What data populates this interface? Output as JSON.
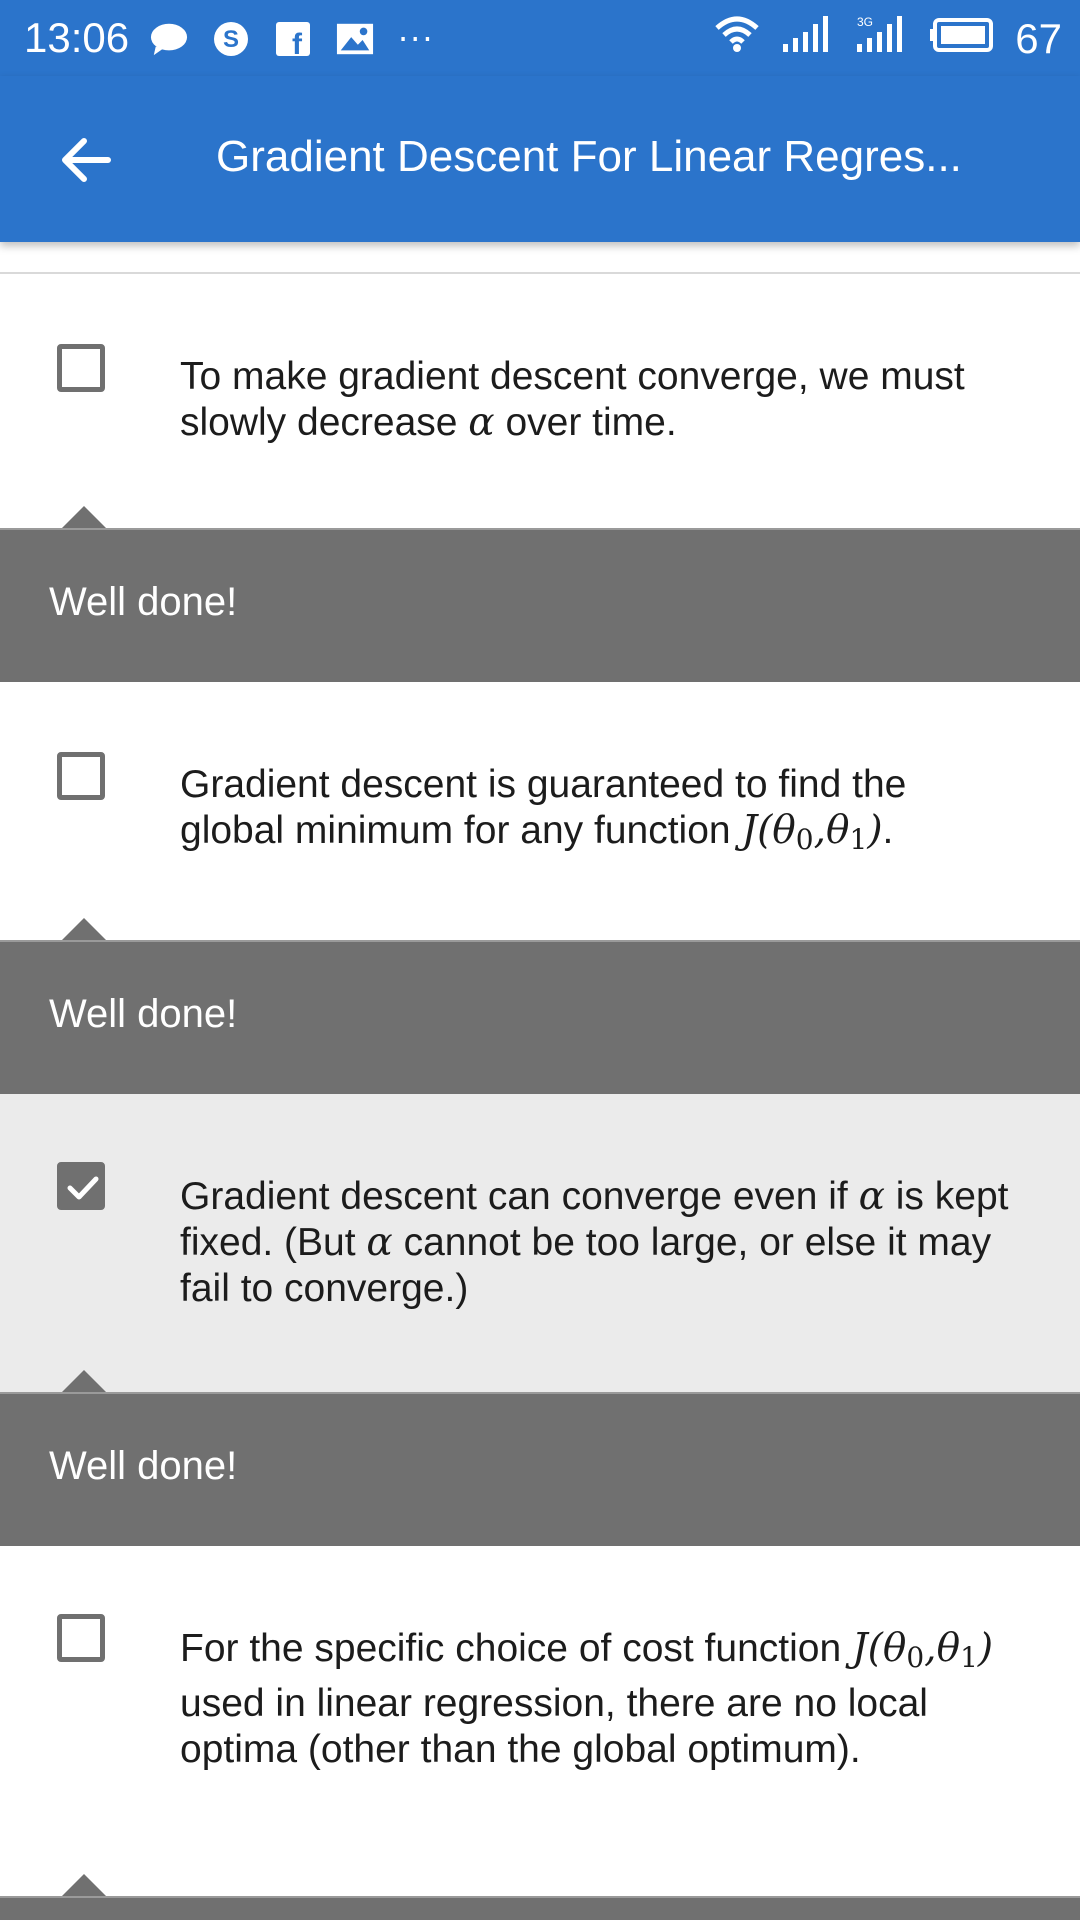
{
  "status_bar": {
    "time": "13:06",
    "battery": "67",
    "left_icons": [
      "chat-bubble-icon",
      "skype-icon",
      "facebook-icon",
      "gallery-icon"
    ],
    "more": "···",
    "network_label": "3G"
  },
  "app_bar": {
    "back_icon": "arrow-left-icon",
    "title": "Gradient Descent For Linear Regres..."
  },
  "options": [
    {
      "checked": false,
      "text_parts": [
        "To make gradient descent converge, we must slowly decrease ",
        "α",
        " over time."
      ]
    },
    {
      "checked": false,
      "text_parts": [
        "Gradient descent is guaranteed to find the global minimum for any function ",
        "J(θ",
        "0",
        ",θ",
        "1",
        ")",
        "."
      ]
    },
    {
      "checked": true,
      "text_parts": [
        "Gradient descent can converge even if ",
        "α",
        " is kept fixed. (But ",
        "α",
        " cannot be too large, or else it may fail to converge.)"
      ]
    },
    {
      "checked": false,
      "text_parts": [
        "For the specific choice of cost function ",
        "J(θ",
        "0",
        ",θ",
        "1",
        ")",
        " used in linear regression, there are no local optima (other than the global optimum)."
      ]
    }
  ],
  "feedback": [
    {
      "text": "Well done!"
    },
    {
      "text": "Well done!"
    },
    {
      "text": "Well done!"
    }
  ],
  "colors": {
    "primary": "#2b74cb",
    "feedback_bg": "#707070",
    "selected_bg": "#ebebeb"
  }
}
